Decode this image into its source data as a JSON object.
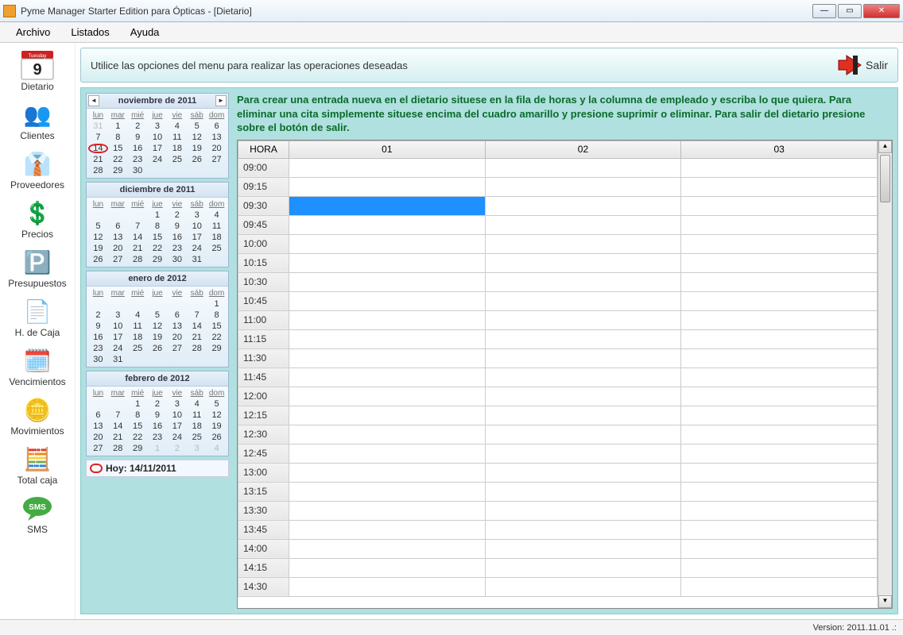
{
  "window": {
    "title": "Pyme Manager Starter Edition para Ópticas - [Dietario]"
  },
  "menu": {
    "archivo": "Archivo",
    "listados": "Listados",
    "ayuda": "Ayuda"
  },
  "sidebar": {
    "items": [
      {
        "key": "dietario",
        "label": "Dietario",
        "icon": "📅"
      },
      {
        "key": "clientes",
        "label": "Clientes",
        "icon": "👥"
      },
      {
        "key": "proveedores",
        "label": "Proveedores",
        "icon": "👔"
      },
      {
        "key": "precios",
        "label": "Precios",
        "icon": "💲"
      },
      {
        "key": "presupuestos",
        "label": "Presupuestos",
        "icon": "🅿️"
      },
      {
        "key": "hcaja",
        "label": "H. de Caja",
        "icon": "📄"
      },
      {
        "key": "vencimientos",
        "label": "Vencimientos",
        "icon": "🗓️"
      },
      {
        "key": "movimientos",
        "label": "Movimientos",
        "icon": "🪙"
      },
      {
        "key": "totalcaja",
        "label": "Total caja",
        "icon": "🧮"
      },
      {
        "key": "sms",
        "label": "SMS",
        "icon": "💬"
      }
    ]
  },
  "hint": {
    "text": "Utilice las opciones del menu para realizar las operaciones deseadas",
    "salir": "Salir"
  },
  "instructions": "Para crear una entrada nueva en el dietario situese en la fila de horas y la columna de empleado y escriba lo que quiera. Para eliminar una cita simplemente situese encima del cuadro amarillo y presione suprimir o eliminar. Para salir del dietario presione sobre el botón de salir.",
  "dow": [
    "lun",
    "mar",
    "mié",
    "jue",
    "vie",
    "sáb",
    "dom"
  ],
  "calendars": [
    {
      "title": "noviembre de 2011",
      "nav": true,
      "leading": [
        31
      ],
      "days": [
        1,
        2,
        3,
        4,
        5,
        6,
        7,
        8,
        9,
        10,
        11,
        12,
        13,
        14,
        15,
        16,
        17,
        18,
        19,
        20,
        21,
        22,
        23,
        24,
        25,
        26,
        27,
        28,
        29,
        30
      ],
      "today": 14
    },
    {
      "title": "diciembre de 2011",
      "nav": false,
      "leading": [
        null,
        null,
        null
      ],
      "days": [
        1,
        2,
        3,
        4,
        5,
        6,
        7,
        8,
        9,
        10,
        11,
        12,
        13,
        14,
        15,
        16,
        17,
        18,
        19,
        20,
        21,
        22,
        23,
        24,
        25,
        26,
        27,
        28,
        29,
        30,
        31
      ]
    },
    {
      "title": "enero de 2012",
      "nav": false,
      "leading": [
        null,
        null,
        null,
        null,
        null,
        null
      ],
      "days": [
        1,
        2,
        3,
        4,
        5,
        6,
        7,
        8,
        9,
        10,
        11,
        12,
        13,
        14,
        15,
        16,
        17,
        18,
        19,
        20,
        21,
        22,
        23,
        24,
        25,
        26,
        27,
        28,
        29,
        30,
        31
      ]
    },
    {
      "title": "febrero de 2012",
      "nav": false,
      "leading": [
        null,
        null
      ],
      "days": [
        1,
        2,
        3,
        4,
        5,
        6,
        7,
        8,
        9,
        10,
        11,
        12,
        13,
        14,
        15,
        16,
        17,
        18,
        19,
        20,
        21,
        22,
        23,
        24,
        25,
        26,
        27,
        28,
        29
      ],
      "trailing": [
        1,
        2,
        3,
        4
      ]
    }
  ],
  "today_footer": "Hoy: 14/11/2011",
  "schedule": {
    "columns": [
      "HORA",
      "01",
      "02",
      "03"
    ],
    "hours": [
      "09:00",
      "09:15",
      "09:30",
      "09:45",
      "10:00",
      "10:15",
      "10:30",
      "10:45",
      "11:00",
      "11:15",
      "11:30",
      "11:45",
      "12:00",
      "12:15",
      "12:30",
      "12:45",
      "13:00",
      "13:15",
      "13:30",
      "13:45",
      "14:00",
      "14:15",
      "14:30"
    ],
    "selected": {
      "hour": "09:30",
      "col": 1
    }
  },
  "status": {
    "version": "Version: 2011.11.01   .:"
  },
  "calendar_icon_day": "9",
  "calendar_icon_dow": "Tuesday"
}
